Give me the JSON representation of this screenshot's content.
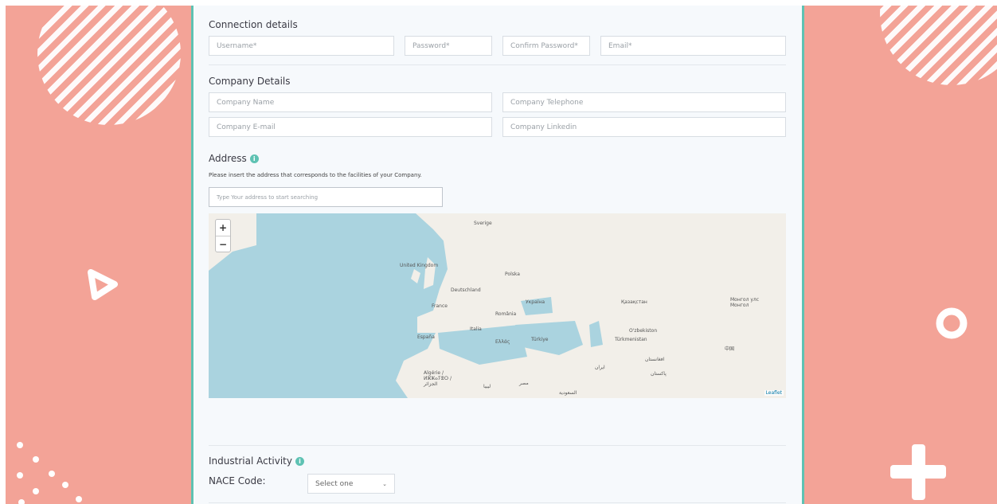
{
  "connection": {
    "title": "Connection details",
    "username_placeholder": "Username*",
    "password_placeholder": "Password*",
    "confirm_placeholder": "Confirm Password*",
    "email_placeholder": "Email*"
  },
  "company": {
    "title": "Company Details",
    "name_placeholder": "Company Name",
    "telephone_placeholder": "Company Telephone",
    "email_placeholder": "Company E-mail",
    "linkedin_placeholder": "Company Linkedin"
  },
  "address": {
    "title": "Address",
    "help_text": "Please insert the address that corresponds to the facilities of your Company.",
    "search_placeholder": "Type Your address to start searching",
    "zoom_in": "+",
    "zoom_out": "−",
    "attribution": "Leaflet",
    "map_labels": [
      "Sverige",
      "United Kingdom",
      "Deutschland",
      "Polska",
      "France",
      "Україна",
      "România",
      "Қазақстан",
      "Монгол улс Монгол",
      "España",
      "Italia",
      "Ελλάς",
      "Türkiye",
      "O'zbekiston",
      "Türkmenistan",
      "中国",
      "Algérie / ⵍⵣⵣⴰⵢⴻⵔ / الجزائر",
      "ليبيا",
      "مصر",
      "السعودية",
      "ایران",
      "افغانستان",
      "پاکستان"
    ]
  },
  "industrial": {
    "title": "Industrial Activity",
    "nace_label": "NACE Code:",
    "nace_select": "Select one"
  },
  "icons": {
    "info": "info-icon",
    "triangle": "triangle-icon",
    "ring": "ring-icon",
    "plus": "plus-icon"
  },
  "colors": {
    "background": "#f3a397",
    "accent": "#5ec2b3",
    "panel": "#f6f9fc",
    "water": "#aad3df",
    "land": "#f2efe9"
  }
}
